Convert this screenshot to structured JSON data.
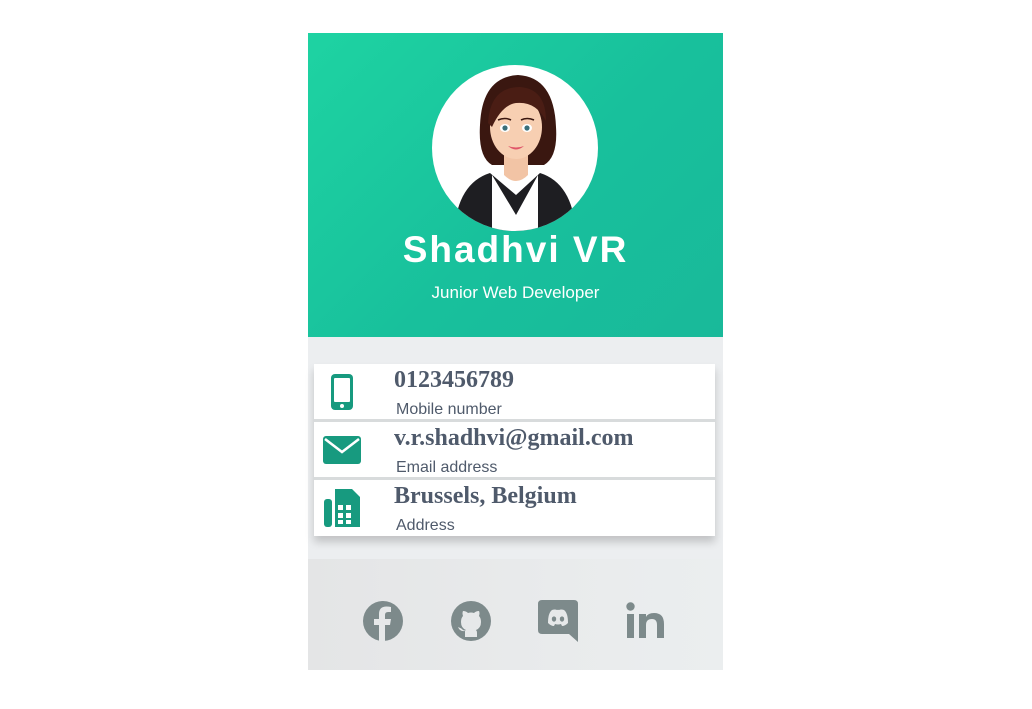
{
  "profile": {
    "name": "Shadhvi VR",
    "role": "Junior Web Developer",
    "avatar_icon": "woman-avatar"
  },
  "contacts": [
    {
      "icon": "mobile-phone-icon",
      "value": "0123456789",
      "label": "Mobile number"
    },
    {
      "icon": "envelope-icon",
      "value": "v.r.shadhvi@gmail.com",
      "label": "Email address"
    },
    {
      "icon": "fax-building-icon",
      "value": "Brussels, Belgium",
      "label": "Address"
    }
  ],
  "social": [
    {
      "icon": "facebook-icon"
    },
    {
      "icon": "github-icon"
    },
    {
      "icon": "discord-icon"
    },
    {
      "icon": "linkedin-icon"
    }
  ],
  "colors": {
    "accent": "#1cc9a0",
    "icon_green": "#179a7f",
    "text": "#4f5a6b",
    "social_icon": "#7d8a8b"
  }
}
